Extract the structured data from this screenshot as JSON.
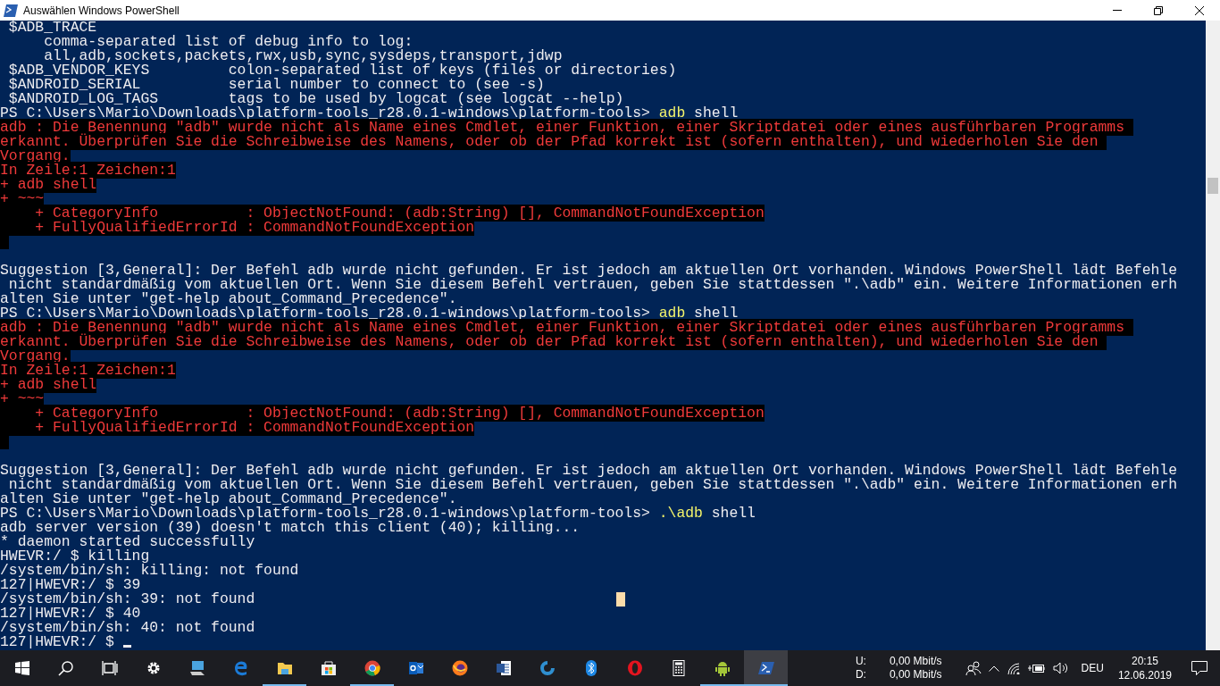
{
  "window": {
    "title": "Auswählen Windows PowerShell"
  },
  "console": {
    "lines": [
      {
        "kind": "text",
        "text": " $ADB_TRACE"
      },
      {
        "kind": "text",
        "text": "     comma-separated list of debug info to log:"
      },
      {
        "kind": "text",
        "text": "     all,adb,sockets,packets,rwx,usb,sync,sysdeps,transport,jdwp"
      },
      {
        "kind": "text",
        "text": " $ADB_VENDOR_KEYS         colon-separated list of keys (files or directories)"
      },
      {
        "kind": "text",
        "text": " $ANDROID_SERIAL          serial number to connect to (see -s)"
      },
      {
        "kind": "text",
        "text": " $ANDROID_LOG_TAGS        tags to be used by logcat (see logcat --help)"
      },
      {
        "kind": "prompt",
        "prompt": "PS C:\\Users\\Mario\\Downloads\\platform-tools_r28.0.1-windows\\platform-tools> ",
        "command": "adb",
        "args": " shell"
      },
      {
        "kind": "error",
        "text": "adb : Die Benennung \"adb\" wurde nicht als Name eines Cmdlet, einer Funktion, einer Skriptdatei oder eines ausführbaren Programms "
      },
      {
        "kind": "error",
        "text": "erkannt. Überprüfen Sie die Schreibweise des Namens, oder ob der Pfad korrekt ist (sofern enthalten), und wiederholen Sie den "
      },
      {
        "kind": "error",
        "text": "Vorgang."
      },
      {
        "kind": "error",
        "text": "In Zeile:1 Zeichen:1"
      },
      {
        "kind": "error",
        "text": "+ adb shell"
      },
      {
        "kind": "error",
        "text": "+ ~~~"
      },
      {
        "kind": "error",
        "text": "    + CategoryInfo          : ObjectNotFound: (adb:String) [], CommandNotFoundException"
      },
      {
        "kind": "error",
        "text": "    + FullyQualifiedErrorId : CommandNotFoundException"
      },
      {
        "kind": "error_gap"
      },
      {
        "kind": "blank"
      },
      {
        "kind": "text",
        "text": "Suggestion [3,General]: Der Befehl adb wurde nicht gefunden. Er ist jedoch am aktuellen Ort vorhanden. Windows PowerShell lädt Befehle"
      },
      {
        "kind": "text",
        "text": " nicht standardmäßig vom aktuellen Ort. Wenn Sie diesem Befehl vertrauen, geben Sie stattdessen \".\\adb\" ein. Weitere Informationen erh"
      },
      {
        "kind": "text",
        "text": "alten Sie unter \"get-help about_Command_Precedence\"."
      },
      {
        "kind": "prompt",
        "prompt": "PS C:\\Users\\Mario\\Downloads\\platform-tools_r28.0.1-windows\\platform-tools> ",
        "command": "adb",
        "args": " shell"
      },
      {
        "kind": "error",
        "text": "adb : Die Benennung \"adb\" wurde nicht als Name eines Cmdlet, einer Funktion, einer Skriptdatei oder eines ausführbaren Programms "
      },
      {
        "kind": "error",
        "text": "erkannt. Überprüfen Sie die Schreibweise des Namens, oder ob der Pfad korrekt ist (sofern enthalten), und wiederholen Sie den "
      },
      {
        "kind": "error",
        "text": "Vorgang."
      },
      {
        "kind": "error",
        "text": "In Zeile:1 Zeichen:1"
      },
      {
        "kind": "error",
        "text": "+ adb shell"
      },
      {
        "kind": "error",
        "text": "+ ~~~"
      },
      {
        "kind": "error",
        "text": "    + CategoryInfo          : ObjectNotFound: (adb:String) [], CommandNotFoundException"
      },
      {
        "kind": "error",
        "text": "    + FullyQualifiedErrorId : CommandNotFoundException"
      },
      {
        "kind": "error_gap"
      },
      {
        "kind": "blank"
      },
      {
        "kind": "text",
        "text": "Suggestion [3,General]: Der Befehl adb wurde nicht gefunden. Er ist jedoch am aktuellen Ort vorhanden. Windows PowerShell lädt Befehle"
      },
      {
        "kind": "text",
        "text": " nicht standardmäßig vom aktuellen Ort. Wenn Sie diesem Befehl vertrauen, geben Sie stattdessen \".\\adb\" ein. Weitere Informationen erh"
      },
      {
        "kind": "text",
        "text": "alten Sie unter \"get-help about_Command_Precedence\"."
      },
      {
        "kind": "prompt",
        "prompt": "PS C:\\Users\\Mario\\Downloads\\platform-tools_r28.0.1-windows\\platform-tools> ",
        "command": ".\\adb",
        "args": " shell"
      },
      {
        "kind": "text",
        "text": "adb server version (39) doesn't match this client (40); killing..."
      },
      {
        "kind": "text",
        "text": "* daemon started successfully"
      },
      {
        "kind": "text",
        "text": "HWEVR:/ $ killing"
      },
      {
        "kind": "text",
        "text": "/system/bin/sh: killing: not found"
      },
      {
        "kind": "text",
        "text": "127|HWEVR:/ $ 39"
      },
      {
        "kind": "text",
        "text": "/system/bin/sh: 39: not found"
      },
      {
        "kind": "text",
        "text": "127|HWEVR:/ $ 40"
      },
      {
        "kind": "text",
        "text": "/system/bin/sh: 40: not found"
      },
      {
        "kind": "text",
        "text": "127|HWEVR:/ $ ",
        "cursor": true
      }
    ]
  },
  "taskbar": {
    "apps": [
      {
        "running": false,
        "selected": false
      },
      {
        "running": false,
        "selected": false
      },
      {
        "running": false,
        "selected": false
      },
      {
        "running": true,
        "selected": false
      },
      {
        "running": false,
        "selected": false
      },
      {
        "running": true,
        "selected": false
      },
      {
        "running": false,
        "selected": false
      },
      {
        "running": false,
        "selected": false
      },
      {
        "running": false,
        "selected": false
      },
      {
        "running": false,
        "selected": false
      },
      {
        "running": false,
        "selected": false
      },
      {
        "running": false,
        "selected": false
      },
      {
        "running": false,
        "selected": false
      },
      {
        "running": true,
        "selected": false
      },
      {
        "running": true,
        "selected": true
      }
    ],
    "tray": {
      "upload_label": "U:",
      "upload_rate": "0,00 Mbit/s",
      "download_label": "D:",
      "download_rate": "0,00 Mbit/s",
      "language": "DEU",
      "time": "20:15",
      "date": "12.06.2019"
    }
  }
}
